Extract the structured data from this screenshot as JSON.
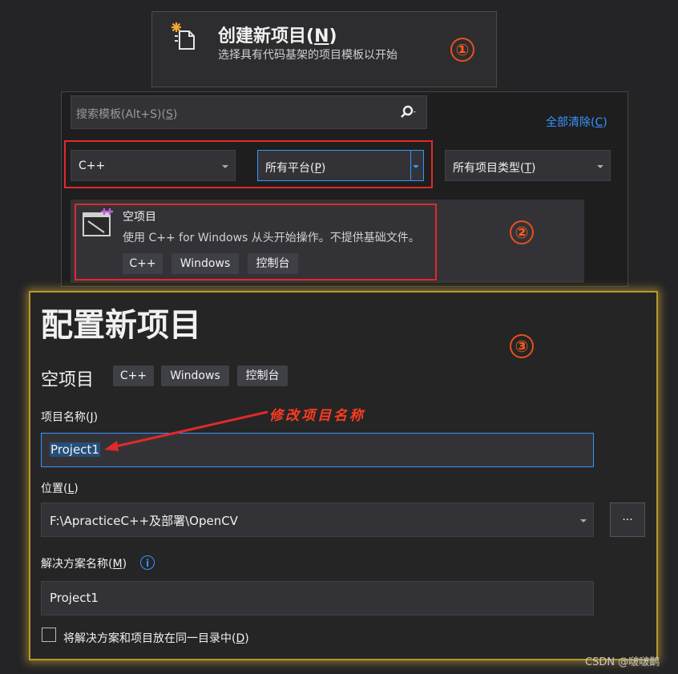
{
  "create": {
    "title": "创建新项目(",
    "title_key": "N",
    "title_end": ")",
    "subtitle": "选择具有代码基架的项目模板以开始",
    "marker": "①"
  },
  "templates": {
    "search_placeholder": "搜索模板(Alt+S)(",
    "search_key": "S",
    "search_end": ")",
    "clear_all": "全部清除(",
    "clear_key": "C",
    "clear_end": ")",
    "language_filter": "C++",
    "platform_filter": "所有平台(",
    "platform_key": "P",
    "platform_end": ")",
    "type_filter": "所有项目类型(",
    "type_key": "T",
    "type_end": ")",
    "template_name": "空项目",
    "template_desc": "使用 C++ for Windows 从头开始操作。不提供基础文件。",
    "template_tags": [
      "C++",
      "Windows",
      "控制台"
    ],
    "marker": "②"
  },
  "configure": {
    "title": "配置新项目",
    "template_name": "空项目",
    "template_tags": [
      "C++",
      "Windows",
      "控制台"
    ],
    "marker": "③",
    "project_name_label": "项目名称(",
    "project_name_key": "J",
    "project_name_end": ")",
    "project_name_value": "Project1",
    "annotation": "修改项目名称",
    "location_label": "位置(",
    "location_key": "L",
    "location_end": ")",
    "location_value": "F:\\ApracticeC++及部署\\OpenCV",
    "browse_label": "...",
    "solution_label": "解决方案名称(",
    "solution_key": "M",
    "solution_end": ")",
    "solution_value": "Project1",
    "same_dir_label": "将解决方案和项目放在同一目录中(",
    "same_dir_key": "D",
    "same_dir_end": ")",
    "same_dir_checked": false
  },
  "watermark": "CSDN @啵啵鹋",
  "colors": {
    "accent": "#3794ff",
    "annotation_red": "#e02a2a",
    "highlight_border": "#b8972f"
  }
}
